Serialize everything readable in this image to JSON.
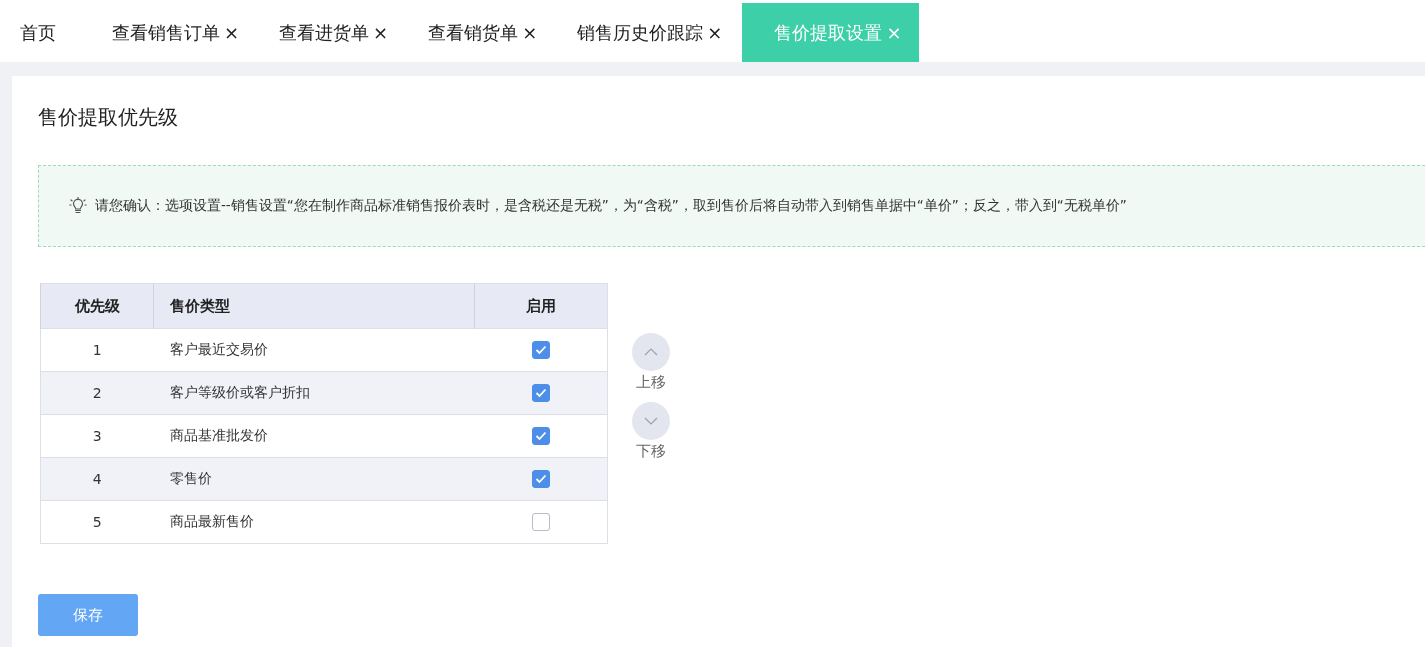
{
  "tabs": [
    {
      "label": "首页",
      "closable": false,
      "selected": false
    },
    {
      "label": "查看销售订单",
      "closable": true,
      "selected": false
    },
    {
      "label": "查看进货单",
      "closable": true,
      "selected": false
    },
    {
      "label": "查看销货单",
      "closable": true,
      "selected": false
    },
    {
      "label": "销售历史价跟踪",
      "closable": true,
      "selected": false
    },
    {
      "label": "售价提取设置",
      "closable": true,
      "selected": true
    }
  ],
  "close_glyph": "×",
  "page_title": "售价提取优先级",
  "notice": "请您确认：选项设置--销售设置“您在制作商品标准销售报价表时，是含税还是无税”，为“含税”，取到售价后将自动带入到销售单据中“单价”；反之，带入到“无税单价”",
  "table": {
    "columns": [
      "优先级",
      "售价类型",
      "启用"
    ],
    "rows": [
      {
        "priority": "1",
        "type": "客户最近交易价",
        "checked": true
      },
      {
        "priority": "2",
        "type": "客户等级价或客户折扣",
        "checked": true
      },
      {
        "priority": "3",
        "type": "商品基准批发价",
        "checked": true
      },
      {
        "priority": "4",
        "type": "零售价",
        "checked": true
      },
      {
        "priority": "5",
        "type": "商品最新售价",
        "checked": false
      }
    ]
  },
  "move_buttons": [
    {
      "kind": "up",
      "label": "上移"
    },
    {
      "kind": "down",
      "label": "下移"
    }
  ],
  "save_button": "保存"
}
